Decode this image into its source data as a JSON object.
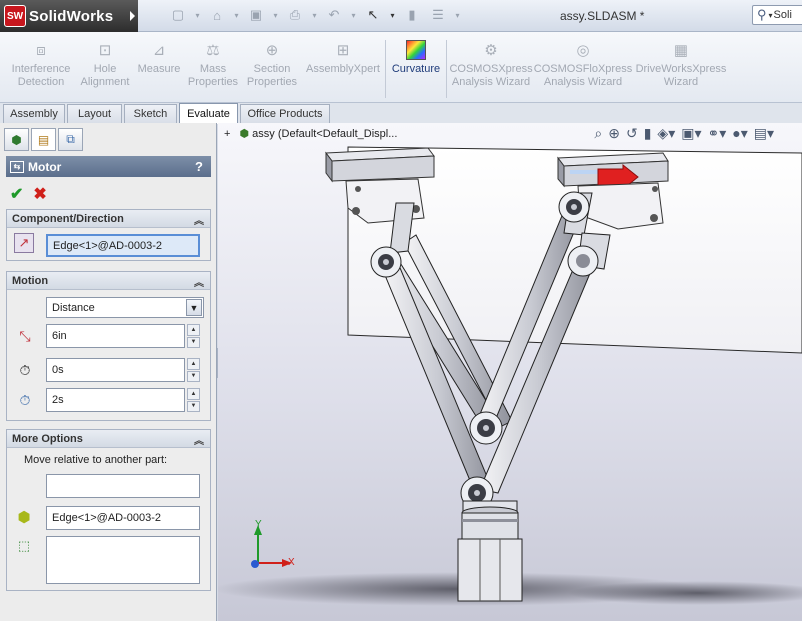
{
  "titlebar": {
    "app_name": "SolidWorks",
    "logo_badge": "SW",
    "document_title": "assy.SLDASM *",
    "search_placeholder": "Soli"
  },
  "ribbon": {
    "buttons": [
      {
        "label": "Interference Detection",
        "line1": "Interference",
        "line2": "Detection",
        "icon": "interference-icon",
        "enabled": false
      },
      {
        "label": "Hole Alignment",
        "line1": "Hole",
        "line2": "Alignment",
        "icon": "hole-alignment-icon",
        "enabled": false
      },
      {
        "label": "Measure",
        "line1": "Measure",
        "line2": "",
        "icon": "measure-icon",
        "enabled": false
      },
      {
        "label": "Mass Properties",
        "line1": "Mass",
        "line2": "Properties",
        "icon": "mass-properties-icon",
        "enabled": false
      },
      {
        "label": "Section Properties",
        "line1": "Section",
        "line2": "Properties",
        "icon": "section-properties-icon",
        "enabled": false
      },
      {
        "label": "AssemblyXpert",
        "line1": "AssemblyXpert",
        "line2": "",
        "icon": "assemblyxpert-icon",
        "enabled": false
      },
      {
        "label": "Curvature",
        "line1": "Curvature",
        "line2": "",
        "icon": "curvature-icon",
        "enabled": true
      },
      {
        "label": "COSMOSXpress Analysis Wizard",
        "line1": "COSMOSXpress",
        "line2": "Analysis Wizard",
        "icon": "cosmosxpress-icon",
        "enabled": false
      },
      {
        "label": "COSMOSFloXpress Analysis Wizard",
        "line1": "COSMOSFloXpress",
        "line2": "Analysis Wizard",
        "icon": "cosmosfloxpress-icon",
        "enabled": false
      },
      {
        "label": "DriveWorksXpress Wizard",
        "line1": "DriveWorksXpress",
        "line2": "Wizard",
        "icon": "driveworksxpress-icon",
        "enabled": false
      }
    ]
  },
  "tabs": [
    "Assembly",
    "Layout",
    "Sketch",
    "Evaluate",
    "Office Products"
  ],
  "active_tab": "Evaluate",
  "property_manager": {
    "title": "Motor",
    "help": "?",
    "ok_symbol": "✔",
    "cancel_symbol": "✖",
    "sections": {
      "component_direction": {
        "title": "Component/Direction",
        "value": "Edge<1>@AD-0003-2"
      },
      "motion": {
        "title": "Motion",
        "type": "Distance",
        "distance": "6in",
        "start_time": "0s",
        "duration": "2s"
      },
      "more_options": {
        "title": "More Options",
        "caption": "Move relative to another part:",
        "relative_part": "",
        "reference": "Edge<1>@AD-0003-2",
        "list": ""
      }
    }
  },
  "feature_tree": {
    "expander": "+",
    "label": "assy  (Default<Default_Displ..."
  },
  "triad": {
    "x": "X",
    "y": "Y"
  },
  "colors": {
    "accent": "#5a8ed6",
    "pm_header": "#5b6e8c",
    "motor_arrow": "#e02020"
  }
}
